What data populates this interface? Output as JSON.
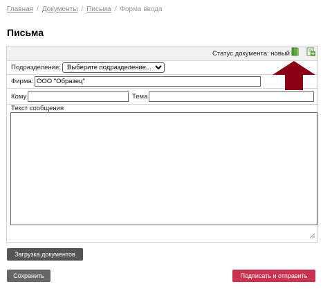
{
  "breadcrumb": {
    "items": [
      "Главная",
      "Документы",
      "Письма"
    ],
    "separator": "/",
    "current_separator": "/",
    "current": "Форма ввода"
  },
  "page_title": "Письма",
  "form": {
    "status_label": "Статус документа:",
    "status_value": "новый",
    "subdivision_label": "Подразделение:",
    "subdivision_selected": "Выберите подразделение...",
    "firm_label": "Фирма:",
    "firm_value": "ООО \"Образец\"",
    "to_label": "Кому",
    "to_value": "",
    "subject_label": "Тема",
    "subject_value": "",
    "message_label": "Текст сообщения",
    "message_value": ""
  },
  "icons": {
    "status_book": "green-book-icon",
    "status_add": "green-add-document-icon"
  },
  "annotation": {
    "arrow_color": "#8b0015"
  },
  "buttons": {
    "upload": "Загрузка документов",
    "save": "Сохранить",
    "sign_send": "Подписать и отправить"
  },
  "colors": {
    "sign_button": "#c8324e",
    "grey_button": "#555555"
  }
}
